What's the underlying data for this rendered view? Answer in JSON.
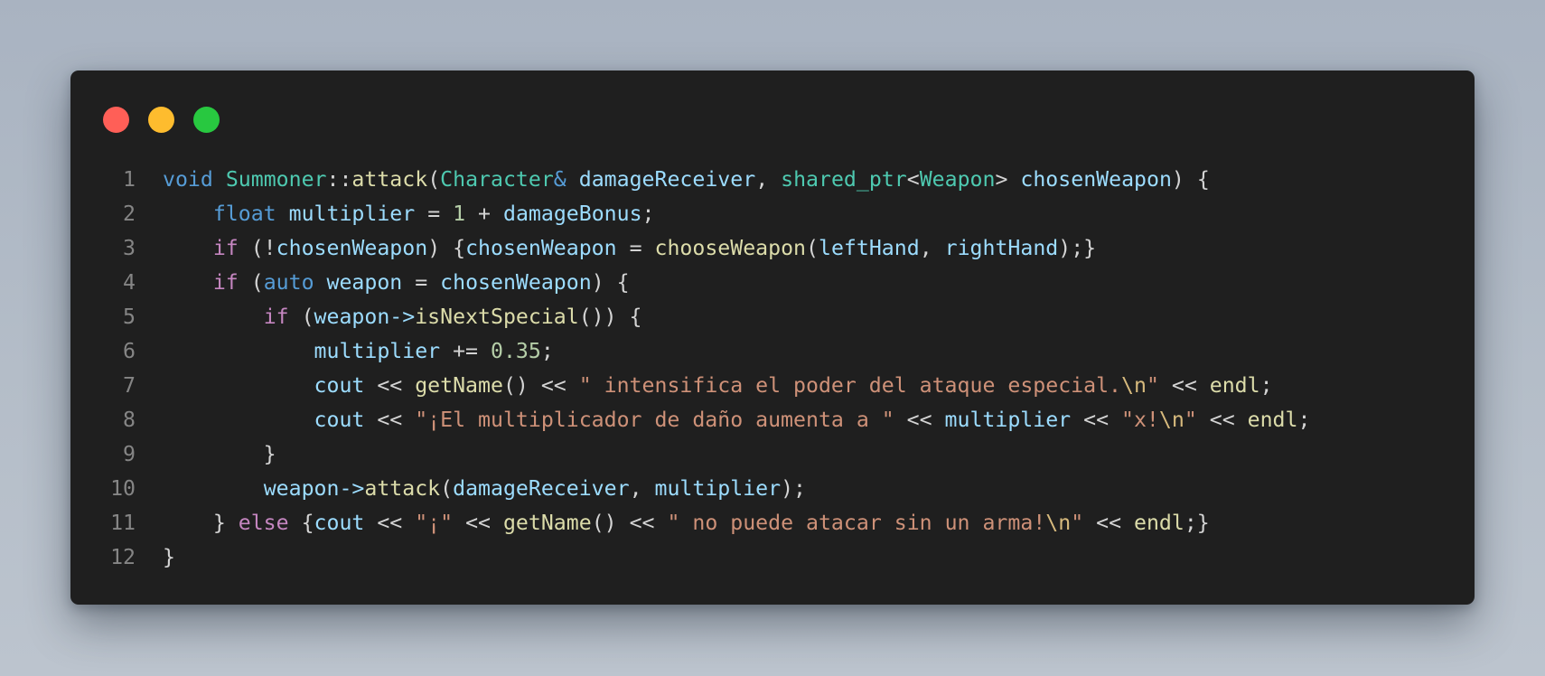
{
  "window": {
    "buttons": [
      {
        "name": "close",
        "color": "#ff5f57"
      },
      {
        "name": "minimize",
        "color": "#febc2e"
      },
      {
        "name": "maximize",
        "color": "#28c840"
      }
    ]
  },
  "colors": {
    "keyword": "#569cd6",
    "control": "#c586c0",
    "type": "#4ec9b0",
    "function": "#dcdcaa",
    "variable": "#9cdcfe",
    "number": "#b5cea8",
    "string": "#ce9178",
    "escape": "#d7ba7d",
    "plain": "#d4d4d4",
    "line_number": "#858585",
    "background": "#1f1f1f"
  },
  "code": {
    "language": "cpp",
    "lines": [
      {
        "number": "1",
        "tokens": [
          {
            "t": "void",
            "k": "kw"
          },
          {
            "t": " ",
            "k": "pun"
          },
          {
            "t": "Summoner",
            "k": "type"
          },
          {
            "t": "::",
            "k": "pun"
          },
          {
            "t": "attack",
            "k": "fn"
          },
          {
            "t": "(",
            "k": "pun"
          },
          {
            "t": "Character",
            "k": "type"
          },
          {
            "t": "&",
            "k": "kw"
          },
          {
            "t": " ",
            "k": "pun"
          },
          {
            "t": "damageReceiver",
            "k": "var"
          },
          {
            "t": ", ",
            "k": "pun"
          },
          {
            "t": "shared_ptr",
            "k": "type"
          },
          {
            "t": "<",
            "k": "pun"
          },
          {
            "t": "Weapon",
            "k": "type"
          },
          {
            "t": ">",
            "k": "pun"
          },
          {
            "t": " ",
            "k": "pun"
          },
          {
            "t": "chosenWeapon",
            "k": "var"
          },
          {
            "t": ") {",
            "k": "pun"
          }
        ]
      },
      {
        "number": "2",
        "tokens": [
          {
            "t": "    ",
            "k": "pun"
          },
          {
            "t": "float",
            "k": "kw"
          },
          {
            "t": " ",
            "k": "pun"
          },
          {
            "t": "multiplier",
            "k": "var"
          },
          {
            "t": " = ",
            "k": "op"
          },
          {
            "t": "1",
            "k": "num"
          },
          {
            "t": " + ",
            "k": "op"
          },
          {
            "t": "damageBonus",
            "k": "var"
          },
          {
            "t": ";",
            "k": "pun"
          }
        ]
      },
      {
        "number": "3",
        "tokens": [
          {
            "t": "    ",
            "k": "pun"
          },
          {
            "t": "if",
            "k": "ctrl"
          },
          {
            "t": " (!",
            "k": "pun"
          },
          {
            "t": "chosenWeapon",
            "k": "var"
          },
          {
            "t": ") {",
            "k": "pun"
          },
          {
            "t": "chosenWeapon",
            "k": "var"
          },
          {
            "t": " = ",
            "k": "op"
          },
          {
            "t": "chooseWeapon",
            "k": "fn"
          },
          {
            "t": "(",
            "k": "pun"
          },
          {
            "t": "leftHand",
            "k": "var"
          },
          {
            "t": ", ",
            "k": "pun"
          },
          {
            "t": "rightHand",
            "k": "var"
          },
          {
            "t": ");}",
            "k": "pun"
          }
        ]
      },
      {
        "number": "4",
        "tokens": [
          {
            "t": "    ",
            "k": "pun"
          },
          {
            "t": "if",
            "k": "ctrl"
          },
          {
            "t": " (",
            "k": "pun"
          },
          {
            "t": "auto",
            "k": "kw"
          },
          {
            "t": " ",
            "k": "pun"
          },
          {
            "t": "weapon",
            "k": "var"
          },
          {
            "t": " = ",
            "k": "op"
          },
          {
            "t": "chosenWeapon",
            "k": "var"
          },
          {
            "t": ") {",
            "k": "pun"
          }
        ]
      },
      {
        "number": "5",
        "tokens": [
          {
            "t": "        ",
            "k": "pun"
          },
          {
            "t": "if",
            "k": "ctrl"
          },
          {
            "t": " (",
            "k": "pun"
          },
          {
            "t": "weapon",
            "k": "var"
          },
          {
            "t": "->",
            "k": "var"
          },
          {
            "t": "isNextSpecial",
            "k": "fn"
          },
          {
            "t": "()) {",
            "k": "pun"
          }
        ]
      },
      {
        "number": "6",
        "tokens": [
          {
            "t": "            ",
            "k": "pun"
          },
          {
            "t": "multiplier",
            "k": "var"
          },
          {
            "t": " += ",
            "k": "op"
          },
          {
            "t": "0.35",
            "k": "num"
          },
          {
            "t": ";",
            "k": "pun"
          }
        ]
      },
      {
        "number": "7",
        "tokens": [
          {
            "t": "            ",
            "k": "pun"
          },
          {
            "t": "cout",
            "k": "var"
          },
          {
            "t": " << ",
            "k": "op"
          },
          {
            "t": "getName",
            "k": "fn"
          },
          {
            "t": "()",
            "k": "pun"
          },
          {
            "t": " << ",
            "k": "op"
          },
          {
            "t": "\" intensifica el poder del ataque especial.",
            "k": "str"
          },
          {
            "t": "\\n",
            "k": "esc"
          },
          {
            "t": "\"",
            "k": "str"
          },
          {
            "t": " << ",
            "k": "op"
          },
          {
            "t": "endl",
            "k": "fn"
          },
          {
            "t": ";",
            "k": "pun"
          }
        ]
      },
      {
        "number": "8",
        "tokens": [
          {
            "t": "            ",
            "k": "pun"
          },
          {
            "t": "cout",
            "k": "var"
          },
          {
            "t": " << ",
            "k": "op"
          },
          {
            "t": "\"¡El multiplicador de daño aumenta a \"",
            "k": "str"
          },
          {
            "t": " << ",
            "k": "op"
          },
          {
            "t": "multiplier",
            "k": "var"
          },
          {
            "t": " << ",
            "k": "op"
          },
          {
            "t": "\"x!",
            "k": "str"
          },
          {
            "t": "\\n",
            "k": "esc"
          },
          {
            "t": "\"",
            "k": "str"
          },
          {
            "t": " << ",
            "k": "op"
          },
          {
            "t": "endl",
            "k": "fn"
          },
          {
            "t": ";",
            "k": "pun"
          }
        ]
      },
      {
        "number": "9",
        "tokens": [
          {
            "t": "        }",
            "k": "pun"
          }
        ]
      },
      {
        "number": "10",
        "tokens": [
          {
            "t": "        ",
            "k": "pun"
          },
          {
            "t": "weapon",
            "k": "var"
          },
          {
            "t": "->",
            "k": "var"
          },
          {
            "t": "attack",
            "k": "fn"
          },
          {
            "t": "(",
            "k": "pun"
          },
          {
            "t": "damageReceiver",
            "k": "var"
          },
          {
            "t": ", ",
            "k": "pun"
          },
          {
            "t": "multiplier",
            "k": "var"
          },
          {
            "t": ");",
            "k": "pun"
          }
        ]
      },
      {
        "number": "11",
        "tokens": [
          {
            "t": "    } ",
            "k": "pun"
          },
          {
            "t": "else",
            "k": "ctrl"
          },
          {
            "t": " {",
            "k": "pun"
          },
          {
            "t": "cout",
            "k": "var"
          },
          {
            "t": " << ",
            "k": "op"
          },
          {
            "t": "\"¡\"",
            "k": "str"
          },
          {
            "t": " << ",
            "k": "op"
          },
          {
            "t": "getName",
            "k": "fn"
          },
          {
            "t": "()",
            "k": "pun"
          },
          {
            "t": " << ",
            "k": "op"
          },
          {
            "t": "\" no puede atacar sin un arma!",
            "k": "str"
          },
          {
            "t": "\\n",
            "k": "esc"
          },
          {
            "t": "\"",
            "k": "str"
          },
          {
            "t": " << ",
            "k": "op"
          },
          {
            "t": "endl",
            "k": "fn"
          },
          {
            "t": ";}",
            "k": "pun"
          }
        ]
      },
      {
        "number": "12",
        "tokens": [
          {
            "t": "}",
            "k": "pun"
          }
        ]
      }
    ]
  }
}
